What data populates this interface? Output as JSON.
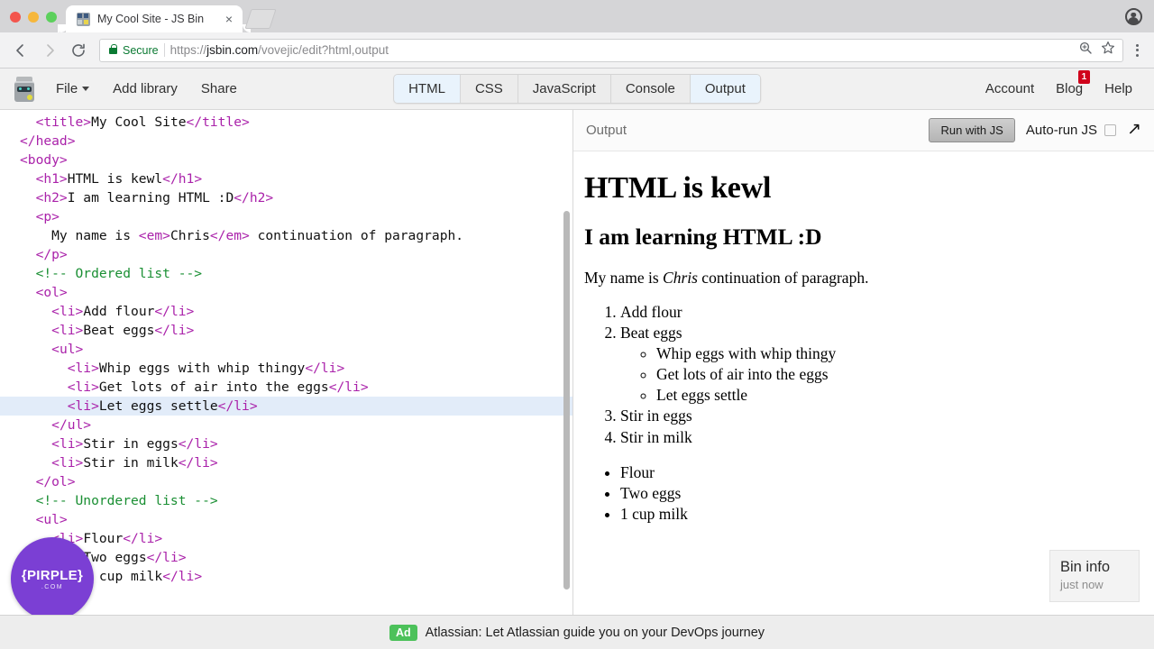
{
  "browser": {
    "tab": {
      "title": "My Cool Site - JS Bin",
      "favicon": "jsbin-favicon",
      "close": "×"
    },
    "omnibox": {
      "secure_label": "Secure",
      "url_scheme": "https://",
      "url_host": "jsbin.com",
      "url_path": "/vovejic/edit?html,output",
      "full_url": "https://jsbin.com/vovejic/edit?html,output"
    },
    "icons": {
      "back": "back-arrow-icon",
      "forward": "forward-arrow-icon",
      "reload": "reload-icon",
      "zoom": "zoom-magnifier-icon",
      "bookmark": "star-icon",
      "menu": "kebab-menu-icon",
      "profile": "account-avatar-icon"
    }
  },
  "toolbar": {
    "logo": "jsbin-robot-logo",
    "file_label": "File",
    "add_library_label": "Add library",
    "share_label": "Share",
    "account_label": "Account",
    "blog_label": "Blog",
    "blog_badge": "1",
    "help_label": "Help",
    "panel_tabs": [
      {
        "label": "HTML",
        "active": true
      },
      {
        "label": "CSS",
        "active": false
      },
      {
        "label": "JavaScript",
        "active": false
      },
      {
        "label": "Console",
        "active": false
      },
      {
        "label": "Output",
        "active": true
      }
    ],
    "active_tab_color": "#e9f3fc"
  },
  "editor": {
    "language": "html",
    "active_line_index": 15,
    "active_line_color": "#e2ecf9",
    "syntax_colors": {
      "tag": "#aa22aa",
      "comment": "#1a8f33",
      "text": "#111111"
    },
    "lines": [
      "  <title>My Cool Site</title>",
      "</head>",
      "<body>",
      "  <h1>HTML is kewl</h1>",
      "  <h2>I am learning HTML :D</h2>",
      "  <p>",
      "    My name is <em>Chris</em> continuation of paragraph.",
      "  </p>",
      "  <!-- Ordered list -->",
      "  <ol>",
      "    <li>Add flour</li>",
      "    <li>Beat eggs</li>",
      "    <ul>",
      "      <li>Whip eggs with whip thingy</li>",
      "      <li>Get lots of air into the eggs</li>",
      "      <li>Let eggs settle</li>",
      "    </ul>",
      "    <li>Stir in eggs</li>",
      "    <li>Stir in milk</li>",
      "  </ol>",
      "  <!-- Unordered list -->",
      "  <ul>",
      "    <li>Flour</li>",
      "    <li>Two eggs</li>",
      "    <li>1 cup milk</li>"
    ]
  },
  "pirple_badge": {
    "word": "{PIRPLE}",
    "sub": ".COM",
    "color": "#7b3fd4"
  },
  "output": {
    "header_label": "Output",
    "run_button": "Run with JS",
    "autorun_label": "Auto-run JS",
    "autorun_checked": false,
    "popout_icon": "popout-arrow-icon",
    "h1": "HTML is kewl",
    "h2": "I am learning HTML :D",
    "paragraph_before": "My name is ",
    "paragraph_em": "Chris",
    "paragraph_after": " continuation of paragraph.",
    "ordered_list": [
      "Add flour",
      "Beat eggs",
      "Stir in eggs",
      "Stir in milk"
    ],
    "nested_list": [
      "Whip eggs with whip thingy",
      "Get lots of air into the eggs",
      "Let eggs settle"
    ],
    "unordered_list": [
      "Flour",
      "Two eggs",
      "1 cup milk"
    ],
    "bin_info": {
      "title": "Bin info",
      "subtitle": "just now"
    }
  },
  "ad": {
    "chip": "Ad",
    "text": "Atlassian: Let Atlassian guide you on your DevOps journey"
  }
}
